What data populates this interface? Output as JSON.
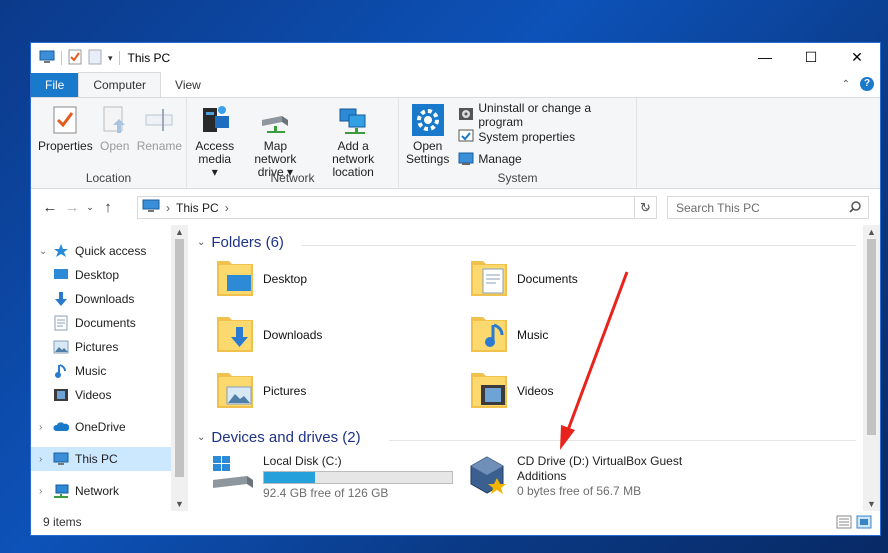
{
  "window": {
    "title": "This PC",
    "controls": {
      "minimize": "—",
      "maximize": "☐",
      "close": "✕"
    }
  },
  "ribbon_tabs": [
    {
      "label": "File"
    },
    {
      "label": "Computer"
    },
    {
      "label": "View"
    }
  ],
  "ribbon": {
    "location": {
      "label": "Location",
      "buttons": [
        {
          "label": "Properties",
          "icon": "properties-icon"
        },
        {
          "label": "Open",
          "icon": "open-icon"
        },
        {
          "label": "Rename",
          "icon": "rename-icon"
        }
      ]
    },
    "network": {
      "label": "Network",
      "buttons": [
        {
          "line1": "Access",
          "line2": "media",
          "icon": "access-media-icon"
        },
        {
          "line1": "Map network",
          "line2": "drive",
          "icon": "map-drive-icon"
        },
        {
          "line1": "Add a network",
          "line2": "location",
          "icon": "network-location-icon"
        }
      ]
    },
    "system": {
      "label": "System",
      "open_settings": {
        "line1": "Open",
        "line2": "Settings",
        "icon": "gear-icon"
      },
      "small": [
        {
          "label": "Uninstall or change a program",
          "icon": "uninstall-icon"
        },
        {
          "label": "System properties",
          "icon": "system-properties-icon"
        },
        {
          "label": "Manage",
          "icon": "manage-icon"
        }
      ]
    }
  },
  "address": {
    "crumb": "This PC",
    "search_placeholder": "Search This PC"
  },
  "nav_pane": {
    "items": [
      {
        "label": "Quick access",
        "icon": "star-icon",
        "expander": "⌄"
      },
      {
        "label": "Desktop",
        "icon": "desktop-icon",
        "pinned": true
      },
      {
        "label": "Downloads",
        "icon": "downloads-icon",
        "pinned": true
      },
      {
        "label": "Documents",
        "icon": "documents-icon",
        "pinned": true
      },
      {
        "label": "Pictures",
        "icon": "pictures-icon",
        "pinned": true
      },
      {
        "label": "Music",
        "icon": "music-icon"
      },
      {
        "label": "Videos",
        "icon": "videos-icon"
      },
      {
        "label": "OneDrive",
        "icon": "onedrive-icon",
        "expander": "›"
      },
      {
        "label": "This PC",
        "icon": "this-pc-icon",
        "expander": "›",
        "selected": true
      },
      {
        "label": "Network",
        "icon": "network-icon",
        "expander": "›"
      }
    ]
  },
  "content": {
    "folders_header": "Folders (6)",
    "folders": [
      {
        "label": "Desktop",
        "icon": "desktop-folder-icon"
      },
      {
        "label": "Documents",
        "icon": "documents-folder-icon"
      },
      {
        "label": "Downloads",
        "icon": "downloads-folder-icon"
      },
      {
        "label": "Music",
        "icon": "music-folder-icon"
      },
      {
        "label": "Pictures",
        "icon": "pictures-folder-icon"
      },
      {
        "label": "Videos",
        "icon": "videos-folder-icon"
      }
    ],
    "drives_header": "Devices and drives (2)",
    "drives": [
      {
        "name": "Local Disk (C:)",
        "free": "92.4 GB free of 126 GB",
        "used_fraction": 0.27,
        "icon": "local-disk-icon"
      },
      {
        "name_line1": "CD Drive (D:) VirtualBox Guest",
        "name_line2": "Additions",
        "free": "0 bytes free of 56.7 MB",
        "icon": "virtualbox-cd-icon"
      }
    ]
  },
  "status": {
    "items": "9 items"
  },
  "colors": {
    "accent": "#1979ca",
    "selection": "#cce8ff",
    "header_text": "#1e3287",
    "arrow": "#e8231c",
    "bar_fill": "#26a0da"
  }
}
